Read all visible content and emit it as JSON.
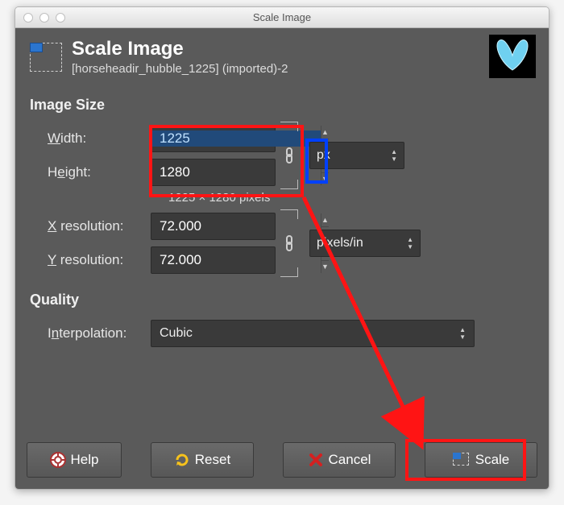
{
  "titlebar": {
    "title": "Scale Image"
  },
  "header": {
    "title": "Scale Image",
    "subtitle": "[horseheadir_hubble_1225] (imported)-2"
  },
  "imageSize": {
    "section": "Image Size",
    "widthLabel": "Width:",
    "widthValue": "1225",
    "heightLabel": "Height:",
    "heightValue": "1280",
    "unit": "px",
    "hint": "1225 × 1280 pixels"
  },
  "resolution": {
    "xLabel": "X resolution:",
    "xValue": "72.000",
    "yLabel": "Y resolution:",
    "yValue": "72.000",
    "unit": "pixels/in"
  },
  "quality": {
    "section": "Quality",
    "interpLabel": "Interpolation:",
    "interpValue": "Cubic"
  },
  "buttons": {
    "help": "Help",
    "reset": "Reset",
    "cancel": "Cancel",
    "scale": "Scale"
  }
}
